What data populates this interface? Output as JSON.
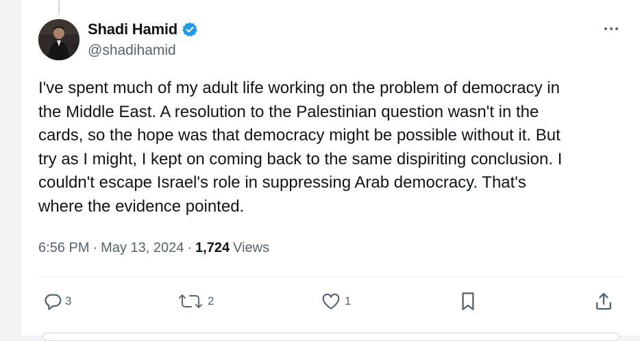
{
  "author": {
    "name": "Shadi Hamid",
    "handle": "@shadihamid",
    "avatar_icon": "profile-photo",
    "verified_icon": "verified-badge-icon",
    "verified_color": "#1d9bf0"
  },
  "tweet": {
    "lines": [
      "I've spent much of my adult life working on the problem of democracy in",
      "the Middle East. A resolution to the Palestinian question wasn't in the",
      "cards, so the hope was that democracy might be possible without it. But",
      "try as I might, I kept on coming back to the same dispiriting conclusion. I",
      "couldn't escape Israel's role in suppressing Arab democracy. That's",
      "where the evidence pointed."
    ]
  },
  "meta": {
    "time": "6:56 PM",
    "separator": "·",
    "date": "May 13, 2024",
    "views_count": "1,724",
    "views_label": "Views"
  },
  "actions": {
    "replies": "3",
    "reposts": "2",
    "likes": "1"
  },
  "icons": {
    "more": "more-options-icon",
    "reply": "reply-icon",
    "repost": "repost-icon",
    "like": "heart-icon",
    "bookmark": "bookmark-icon",
    "share": "share-icon"
  },
  "colors": {
    "text": "#0f1419",
    "secondary": "#536471",
    "accent": "#1d9bf0",
    "divider": "#eff3f4"
  }
}
